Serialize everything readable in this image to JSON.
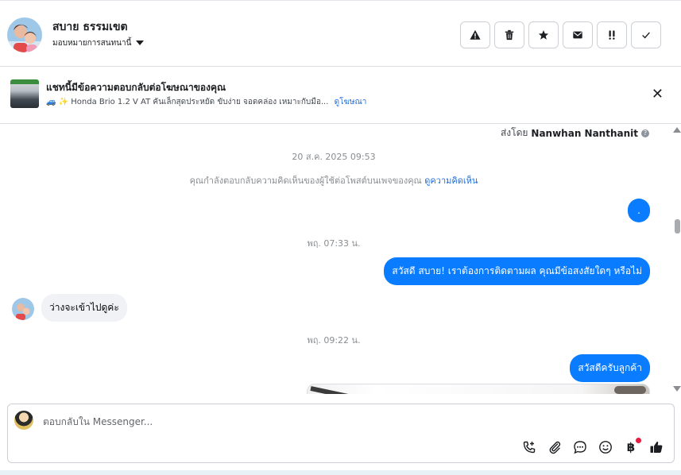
{
  "header": {
    "contact_name": "สบาย ธรรมเขต",
    "assign_label": "มอบหมายการสนทนานี้",
    "actions": [
      {
        "icon": "warning-icon",
        "glyph": "⚠"
      },
      {
        "icon": "trash-icon",
        "glyph": ""
      },
      {
        "icon": "star-icon",
        "glyph": "★"
      },
      {
        "icon": "mail-icon",
        "glyph": ""
      },
      {
        "icon": "follow-up-icon",
        "glyph": "!!"
      },
      {
        "icon": "check-icon",
        "glyph": "✓"
      }
    ]
  },
  "banner": {
    "title": "แชทนี้มีข้อความตอบกลับต่อโฆษณาของคุณ",
    "subtitle": "🚙 ✨ Honda Brio 1.2 V AT คันเล็กสุดประหยัด ขับง่าย จอดคล่อง เหมาะกับมือ...",
    "link": "ดูโฆษณา",
    "close_glyph": "✕"
  },
  "conversation": {
    "sent_by_prefix": "ส่งโดย",
    "sent_by_name": "Nanwhan Nanthanit",
    "info_glyph": "?",
    "timestamp_1": "20 ส.ค. 2025 09:53",
    "system_text": "คุณกำลังตอบกลับความคิดเห็นของผู้ใช้ต่อโพสต์บนเพจของคุณ",
    "system_link": "ดูความคิดเห็น",
    "msg_dot": ".",
    "timestamp_2": "พฤ. 07:33 น.",
    "msg_out_1": "สวัสดี สบาย! เราต้องการติดตามผล คุณมีข้อสงสัยใดๆ หรือไม่",
    "msg_in_1": "ว่างจะเข้าไปดูค่ะ",
    "timestamp_3": "พฤ. 09:22 น.",
    "msg_out_2": "สวัสดีครับลูกค้า"
  },
  "composer": {
    "placeholder": "ตอบกลับใน Messenger...",
    "tools": [
      "reply-options-icon",
      "attachment-icon",
      "saved-replies-icon",
      "emoji-icon",
      "payment-icon",
      "thumbs-up-icon"
    ],
    "baht_glyph": "฿"
  },
  "colors": {
    "accent": "#0a7cff",
    "link": "#216fdb",
    "incoming_bubble": "#f0f2f5",
    "notification": "#e41e3f"
  }
}
